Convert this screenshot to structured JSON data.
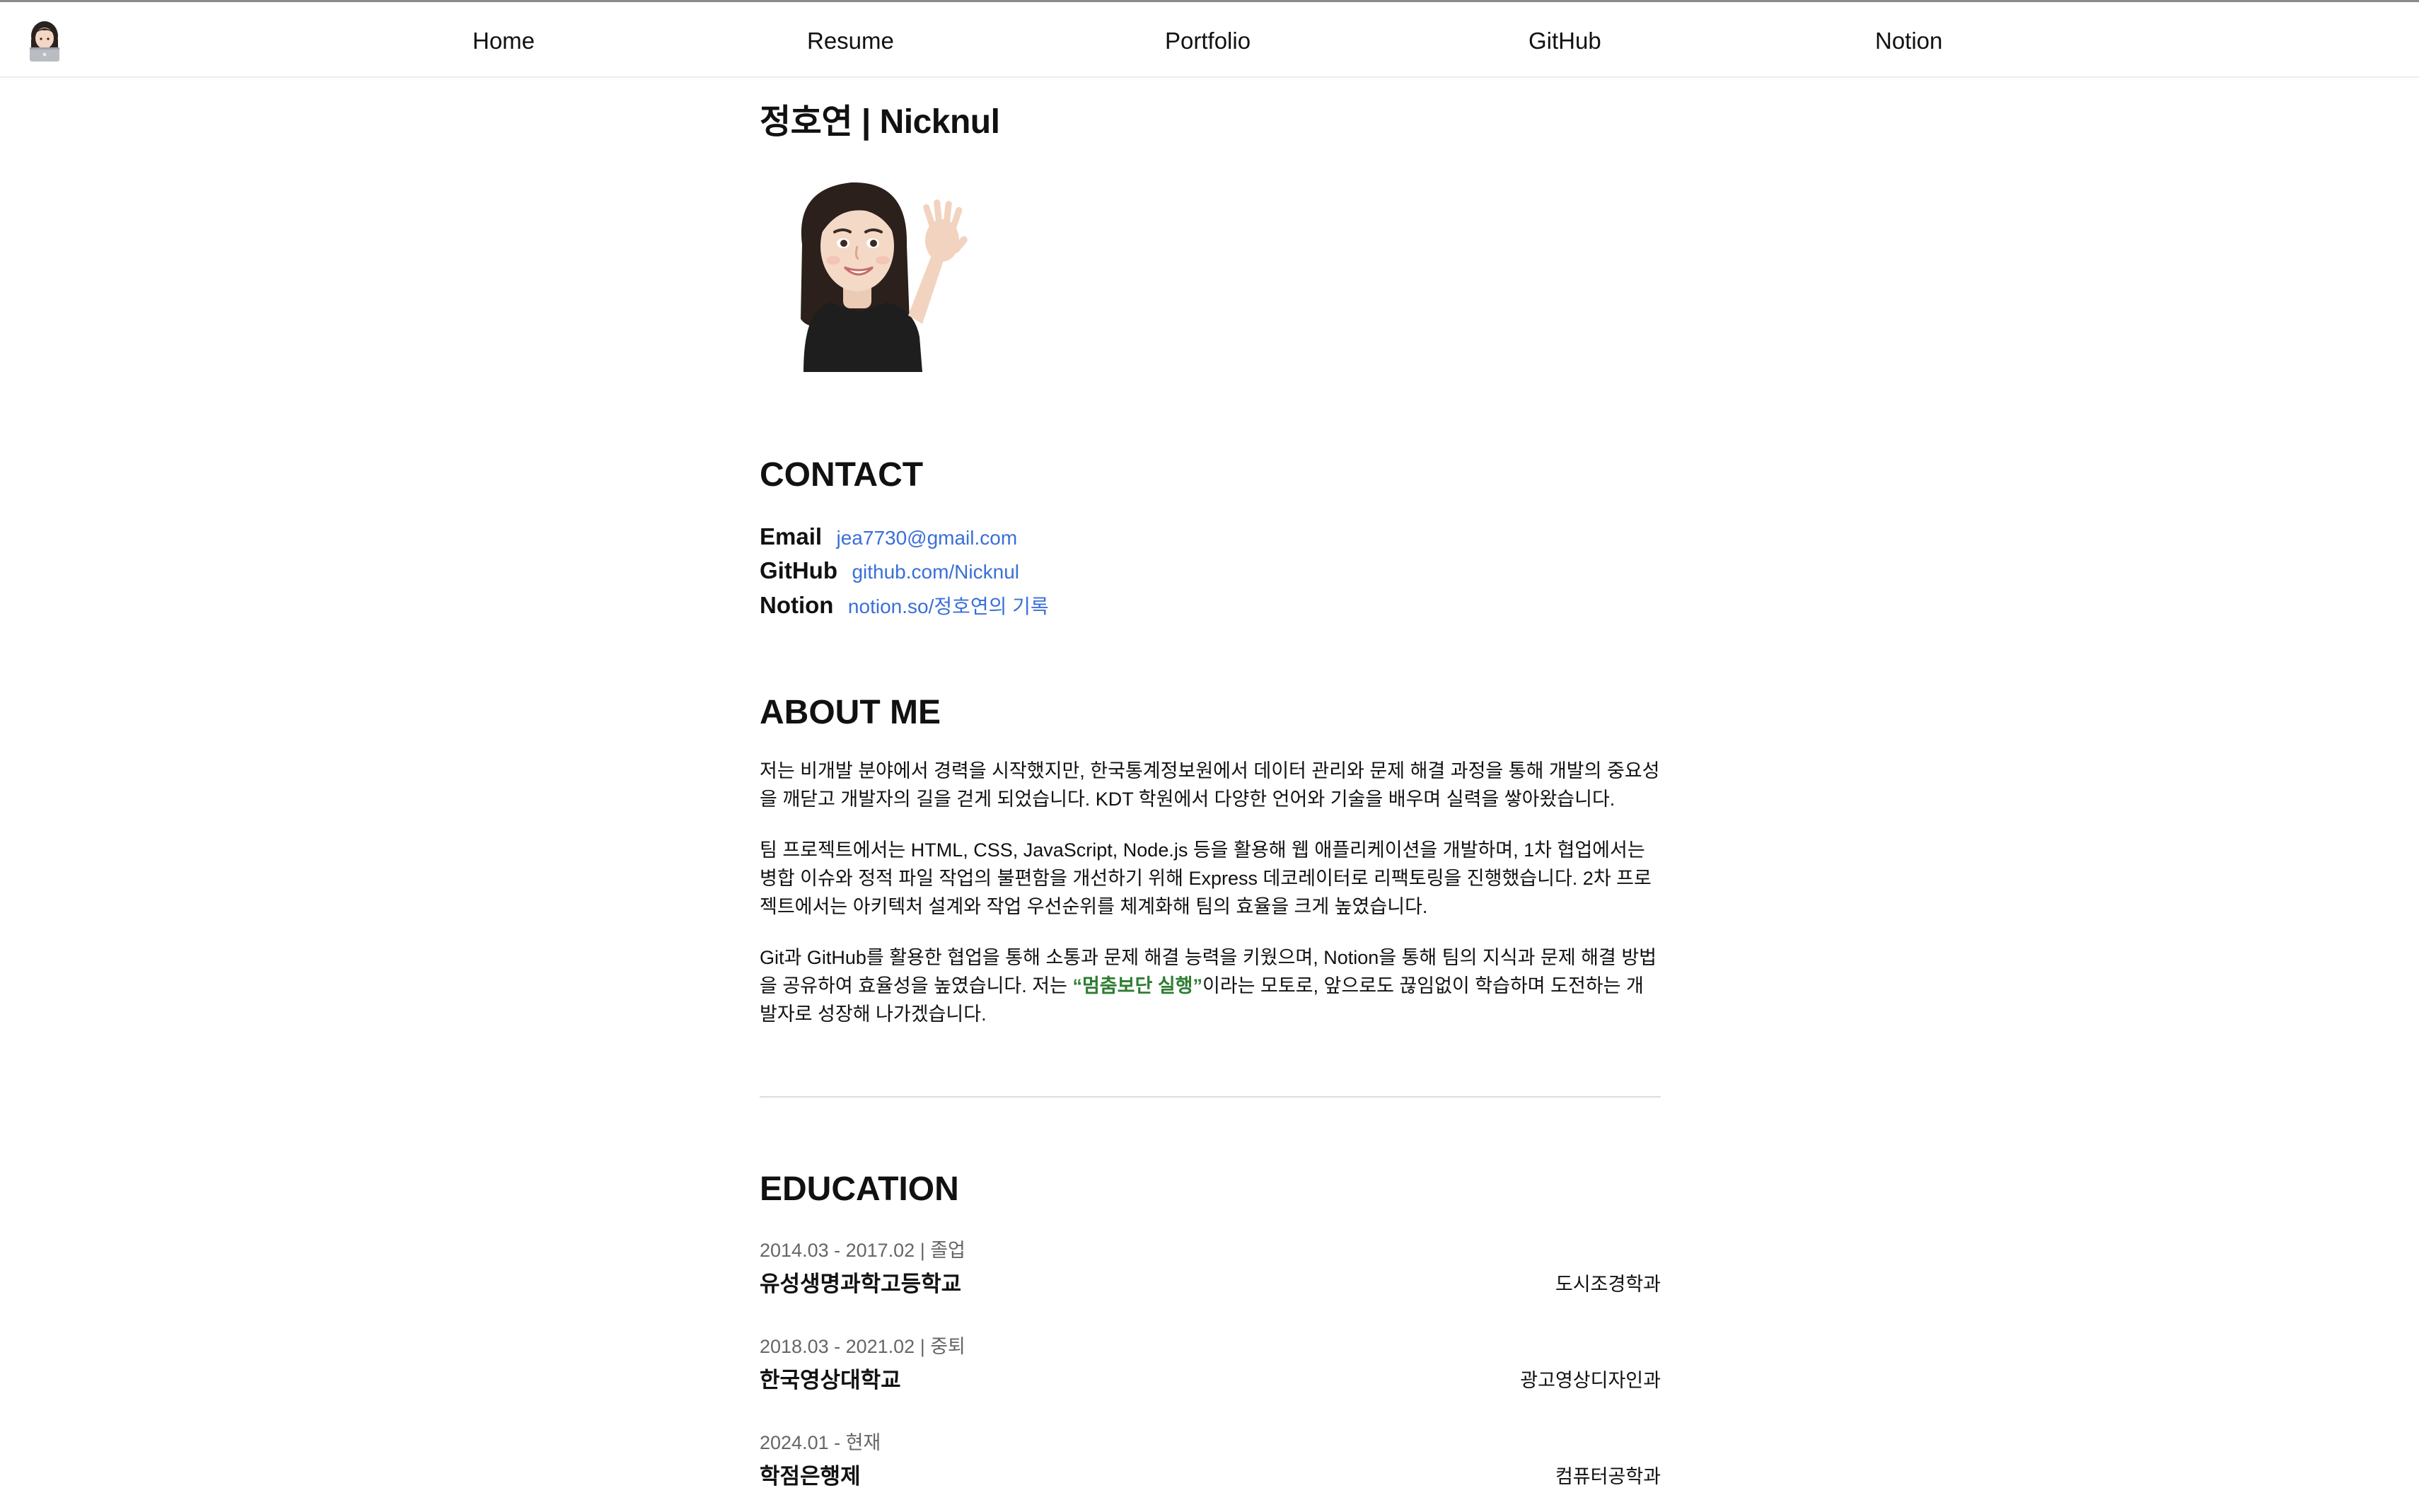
{
  "nav": {
    "items": [
      {
        "label": "Home"
      },
      {
        "label": "Resume"
      },
      {
        "label": "Portfolio"
      },
      {
        "label": "GitHub"
      },
      {
        "label": "Notion"
      }
    ]
  },
  "profile": {
    "title": "정호연 | Nicknul",
    "avatar_icon": "waving-memoji-avatar"
  },
  "contact": {
    "heading": "CONTACT",
    "rows": [
      {
        "label": "Email",
        "value": "jea7730@gmail.com"
      },
      {
        "label": "GitHub",
        "value": "github.com/Nicknul"
      },
      {
        "label": "Notion",
        "value": "notion.so/정호연의 기록"
      }
    ]
  },
  "about": {
    "heading": "ABOUT ME",
    "p1": "저는 비개발 분야에서 경력을 시작했지만, 한국통계정보원에서 데이터 관리와 문제 해결 과정을 통해 개발의 중요성을 깨닫고 개발자의 길을 걷게 되었습니다. KDT 학원에서 다양한 언어와 기술을 배우며 실력을 쌓아왔습니다.",
    "p2": "팀 프로젝트에서는 HTML, CSS, JavaScript, Node.js 등을 활용해 웹 애플리케이션을 개발하며, 1차 협업에서는 병합 이슈와 정적 파일 작업의 불편함을 개선하기 위해 Express 데코레이터로 리팩토링을 진행했습니다. 2차 프로젝트에서는 아키텍처 설계와 작업 우선순위를 체계화해 팀의 효율을 크게 높였습니다.",
    "p3_before": "Git과 GitHub를 활용한 협업을 통해 소통과 문제 해결 능력을 키웠으며, Notion을 통해 팀의 지식과 문제 해결 방법을 공유하여 효율성을 높였습니다. 저는 ",
    "p3_motto": "“멈춤보단 실행”",
    "p3_after": "이라는 모토로, 앞으로도 끊임없이 학습하며 도전하는 개발자로 성장해 나가겠습니다."
  },
  "education": {
    "heading": "EDUCATION",
    "items": [
      {
        "period": "2014.03 - 2017.02 | 졸업",
        "school": "유성생명과학고등학교",
        "major": "도시조경학과"
      },
      {
        "period": "2018.03 - 2021.02 | 중퇴",
        "school": "한국영상대학교",
        "major": "광고영상디자인과"
      },
      {
        "period": "2024.01 - 현재",
        "school": "학점은행제",
        "major": "컴퓨터공학과"
      }
    ]
  },
  "colors": {
    "link": "#3a6fd8",
    "motto": "#2e7d32",
    "muted": "#666666"
  }
}
